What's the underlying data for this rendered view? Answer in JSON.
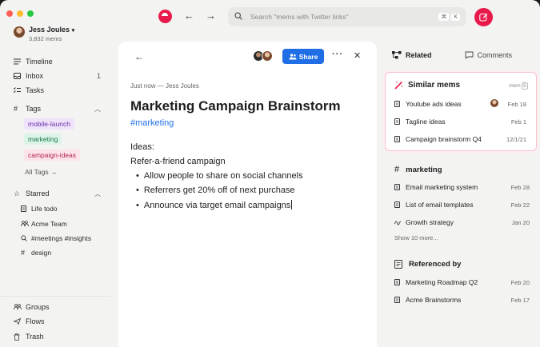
{
  "user": {
    "name": "Jess Joules",
    "mem_count": "3,832 mems"
  },
  "nav": [
    {
      "label": "Timeline",
      "icon": "timeline-icon",
      "count": ""
    },
    {
      "label": "Inbox",
      "icon": "inbox-icon",
      "count": "1"
    },
    {
      "label": "Tasks",
      "icon": "tasks-icon",
      "count": ""
    }
  ],
  "tags_section": {
    "title": "Tags",
    "tags": [
      {
        "label": "mobile-launch",
        "bg": "#efe3fb",
        "fg": "#6b2fa8"
      },
      {
        "label": "marketing",
        "bg": "#dcf3e8",
        "fg": "#1f7a4a"
      },
      {
        "label": "campaign-ideas",
        "bg": "#fde3ea",
        "fg": "#b0284d"
      }
    ],
    "all_tags": "All Tags →"
  },
  "starred_section": {
    "title": "Starred",
    "items": [
      {
        "label": "Life todo",
        "icon": "document-icon"
      },
      {
        "label": "Acme Team",
        "icon": "team-icon"
      },
      {
        "label": "#meetings #insights",
        "icon": "search-icon"
      },
      {
        "label": "design",
        "icon": "hash-icon"
      }
    ]
  },
  "bottom_nav": [
    {
      "label": "Groups",
      "icon": "groups-icon"
    },
    {
      "label": "Flows",
      "icon": "flows-icon"
    },
    {
      "label": "Trash",
      "icon": "trash-icon"
    }
  ],
  "search": {
    "placeholder": "Search \"mems with Twitter links\"",
    "shortcut_1": "⌘",
    "shortcut_2": "K"
  },
  "colors": {
    "brand": "#e8194b",
    "accent_blue": "#1f6ee6"
  },
  "mem": {
    "share_label": "Share",
    "meta": "Just now — Jess Joules",
    "title": "Marketing Campaign Brainstorm",
    "hashtag": "#marketing",
    "line1": "Ideas:",
    "line2": "Refer-a-friend campaign",
    "bullets": [
      "Allow people to share on social channels",
      "Referrers get 20% off of next purchase",
      "Announce via target email campaigns"
    ]
  },
  "right_panel": {
    "tab_related": "Related",
    "tab_comments": "Comments",
    "similar": {
      "title": "Similar mems",
      "shortcut_label": "mem",
      "shortcut_key": "S",
      "items": [
        {
          "label": "Youtube ads ideas",
          "date": "Feb 18"
        },
        {
          "label": "Tagline ideas",
          "date": "Feb 1"
        },
        {
          "label": "Campaign brainstorm Q4",
          "date": "12/1/21"
        }
      ]
    },
    "tag_section": {
      "title": "marketing",
      "items": [
        {
          "label": "Email marketing system",
          "date": "Feb 28",
          "icon": "document-icon"
        },
        {
          "label": "List of email templates",
          "date": "Feb 22",
          "icon": "document-icon"
        },
        {
          "label": "Growth strategy",
          "date": "Jan 20",
          "icon": "squiggle-icon"
        }
      ],
      "show_more": "Show 10 more..."
    },
    "referenced": {
      "title": "Referenced by",
      "items": [
        {
          "label": "Marketing Roadmap Q2",
          "date": "Feb 20"
        },
        {
          "label": "Acme Brainstorms",
          "date": "Feb 17"
        }
      ]
    }
  }
}
